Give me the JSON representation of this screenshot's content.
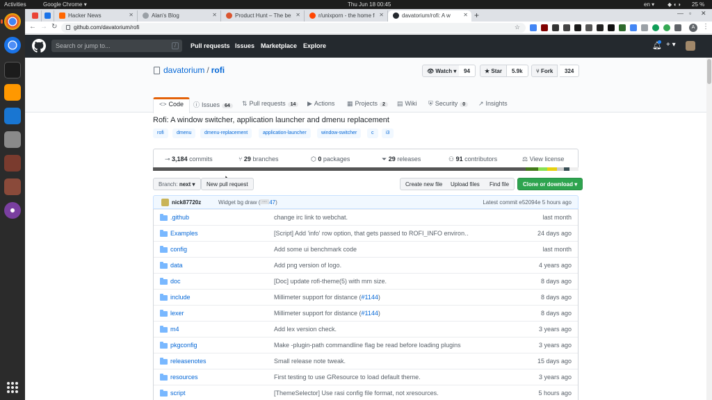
{
  "system_bar": {
    "activities": "Activities",
    "app": "Google Chrome ▾",
    "clock": "Thu Jun 18  00:45",
    "lang": "en ▾",
    "battery": "25 %"
  },
  "browser": {
    "tabs": [
      {
        "label": "Hacker News",
        "favicon_color": "#ff6600"
      },
      {
        "label": "Alan's Blog",
        "favicon_color": "#9aa0a6"
      },
      {
        "label": "Product Hunt – The best n",
        "favicon_color": "#da552f"
      },
      {
        "label": "r/unixporn - the home fo",
        "favicon_color": "#ff4500"
      },
      {
        "label": "davatorium/rofi: A w",
        "favicon_color": "#24292e"
      }
    ],
    "url": "github.com/davatorium/rofi",
    "profile_letter": "A"
  },
  "github": {
    "search_placeholder": "Search or jump to...",
    "slash_key": "/",
    "nav": [
      "Pull requests",
      "Issues",
      "Marketplace",
      "Explore"
    ],
    "plus": "+ ▾"
  },
  "repo": {
    "owner": "davatorium",
    "separator": "/",
    "name": "rofi",
    "watch_label": "Watch ▾",
    "watch_count": "94",
    "star_label": "Star",
    "star_count": "5.9k",
    "fork_label": "Fork",
    "fork_count": "324",
    "tabs": [
      {
        "icon": "<>",
        "label": "Code",
        "count": ""
      },
      {
        "icon": "ⓘ",
        "label": "Issues",
        "count": "64"
      },
      {
        "icon": "⇅",
        "label": "Pull requests",
        "count": "14"
      },
      {
        "icon": "▶",
        "label": "Actions",
        "count": ""
      },
      {
        "icon": "▦",
        "label": "Projects",
        "count": "2"
      },
      {
        "icon": "▤",
        "label": "Wiki",
        "count": ""
      },
      {
        "icon": "⛨",
        "label": "Security",
        "count": "0"
      },
      {
        "icon": "↗",
        "label": "Insights",
        "count": ""
      }
    ],
    "description": "Rofi: A window switcher, application launcher and dmenu replacement",
    "topics": [
      "rofi",
      "dmenu",
      "dmenu-replacement",
      "application-launcher",
      "window-switcher",
      "c",
      "i3"
    ],
    "summary": {
      "commits_count": "3,184",
      "commits_label": "commits",
      "branches_count": "29",
      "branches_label": "branches",
      "packages_count": "0",
      "packages_label": "packages",
      "releases_count": "29",
      "releases_label": "releases",
      "contributors_count": "91",
      "contributors_label": "contributors",
      "license_label": "View license"
    },
    "language_colors": [
      "#555555",
      "#427819",
      "#89e051",
      "#e6d10f",
      "#cccccc",
      "#384d54",
      "#eeeeee"
    ],
    "branch_label": "Branch:",
    "branch_name": "next ▾",
    "new_pr": "New pull request",
    "create_file": "Create new file",
    "upload_files": "Upload files",
    "find_file": "Find file",
    "clone": "Clone or download ▾",
    "latest_commit": {
      "author": "nick87720z",
      "message": "Widget bg draw (",
      "pr": "#1147",
      "message_end": ")",
      "ellipsis": "···",
      "latest_text": "Latest commit e52094e 5 hours ago"
    },
    "files": [
      {
        "name": ".github",
        "message": "change irc link to webchat.",
        "pr": "",
        "age": "last month"
      },
      {
        "name": "Examples",
        "message": "[Script] Add 'info' row option, that gets passed to ROFI_INFO environ…",
        "pr": "",
        "age": "24 days ago"
      },
      {
        "name": "config",
        "message": "Add some ui benchmark code",
        "pr": "",
        "age": "last month"
      },
      {
        "name": "data",
        "message": "Add png version of logo.",
        "pr": "",
        "age": "4 years ago"
      },
      {
        "name": "doc",
        "message": "[Doc] update rofi-theme(5) with mm size.",
        "pr": "",
        "age": "8 days ago"
      },
      {
        "name": "include",
        "message": "Millimeter support for distance (",
        "pr": "#1144",
        "age": "8 days ago"
      },
      {
        "name": "lexer",
        "message": "Millimeter support for distance (",
        "pr": "#1144",
        "age": "8 days ago"
      },
      {
        "name": "m4",
        "message": "Add lex version check.",
        "pr": "",
        "age": "3 years ago"
      },
      {
        "name": "pkgconfig",
        "message": "Make -plugin-path commandline flag be read before loading plugins",
        "pr": "",
        "age": "3 years ago"
      },
      {
        "name": "releasenotes",
        "message": "Small release note tweak.",
        "pr": "",
        "age": "15 days ago"
      },
      {
        "name": "resources",
        "message": "First testing to use GResource to load default theme.",
        "pr": "",
        "age": "3 years ago"
      },
      {
        "name": "script",
        "message": "[ThemeSelector] Use rasi config file format, not xresources.",
        "pr": "",
        "age": "5 hours ago"
      }
    ]
  }
}
